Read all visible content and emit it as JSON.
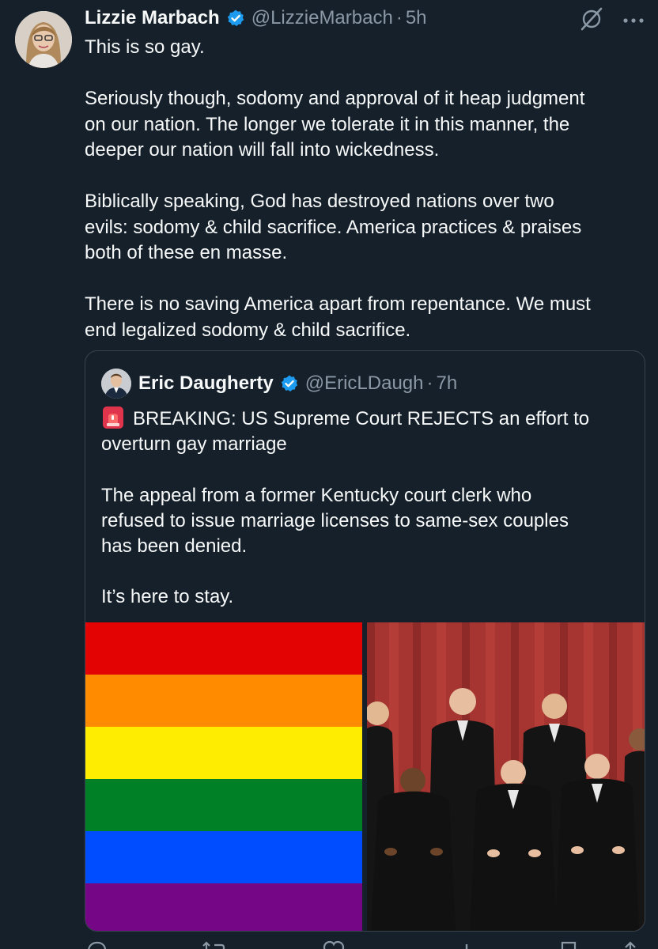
{
  "tweet": {
    "author_name": "Lizzie Marbach",
    "author_handle": "@LizzieMarbach",
    "separator": "·",
    "time": "5h",
    "lines": [
      "This is so gay.",
      "",
      "Seriously though, sodomy and approval of it heap judgment",
      "on our nation. The longer we tolerate it in this manner, the",
      "deeper our nation will fall into wickedness.",
      "",
      "Biblically speaking, God has destroyed nations over two",
      "evils: sodomy & child sacrifice. America practices & praises",
      "both of these en masse.",
      "",
      "There is no saving America apart from repentance. We must",
      "end legalized sodomy & child sacrifice."
    ]
  },
  "quoted_tweet": {
    "author_name": "Eric Daugherty",
    "author_handle": "@EricLDaugh",
    "separator": "·",
    "time": "7h",
    "emoji": "rotating-light",
    "lines": [
      "BREAKING: US Supreme Court REJECTS an effort to",
      "overturn gay marriage",
      "",
      "The appeal from a former Kentucky court clerk who",
      "refused to issue marriage licenses to same-sex couples",
      "has been denied.",
      "",
      "It’s here to stay."
    ],
    "media": {
      "left": "rainbow-pride-flag",
      "right": "supreme-court-justices-photo",
      "flag_colors": [
        "#e40303",
        "#ff8c00",
        "#ffed00",
        "#008026",
        "#004dff",
        "#750787"
      ]
    }
  },
  "icons": {
    "grok": "grok-icon",
    "more": "more-icon",
    "verified": "verified-badge-icon"
  },
  "colors": {
    "background": "#15202b",
    "text": "#f7f9f9",
    "secondary": "#8b98a5",
    "verified": "#1d9bf0",
    "border": "#38444d"
  }
}
